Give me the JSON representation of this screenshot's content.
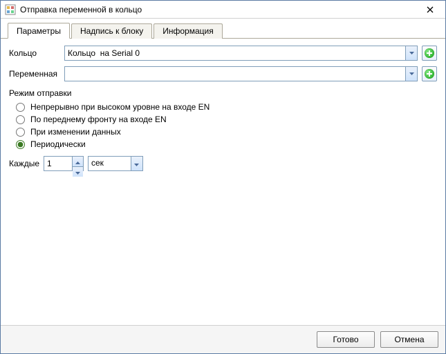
{
  "window": {
    "title": "Отправка переменной в кольцо"
  },
  "tabs": {
    "parameters": "Параметры",
    "caption": "Надпись к блоку",
    "info": "Информация",
    "active_index": 0
  },
  "fields": {
    "ring_label": "Кольцо",
    "ring_value": "Кольцо  на Serial 0",
    "variable_label": "Переменная",
    "variable_value": ""
  },
  "send_mode": {
    "group_label": "Режим отправки",
    "options": {
      "continuous": "Непрерывно при высоком уровне на входе EN",
      "front": "По переднему фронту на входе EN",
      "onchange": "При изменении данных",
      "periodic": "Периодически"
    },
    "selected": "periodic"
  },
  "period": {
    "label": "Каждые",
    "value": "1",
    "unit": "сек"
  },
  "footer": {
    "ok": "Готово",
    "cancel": "Отмена"
  }
}
